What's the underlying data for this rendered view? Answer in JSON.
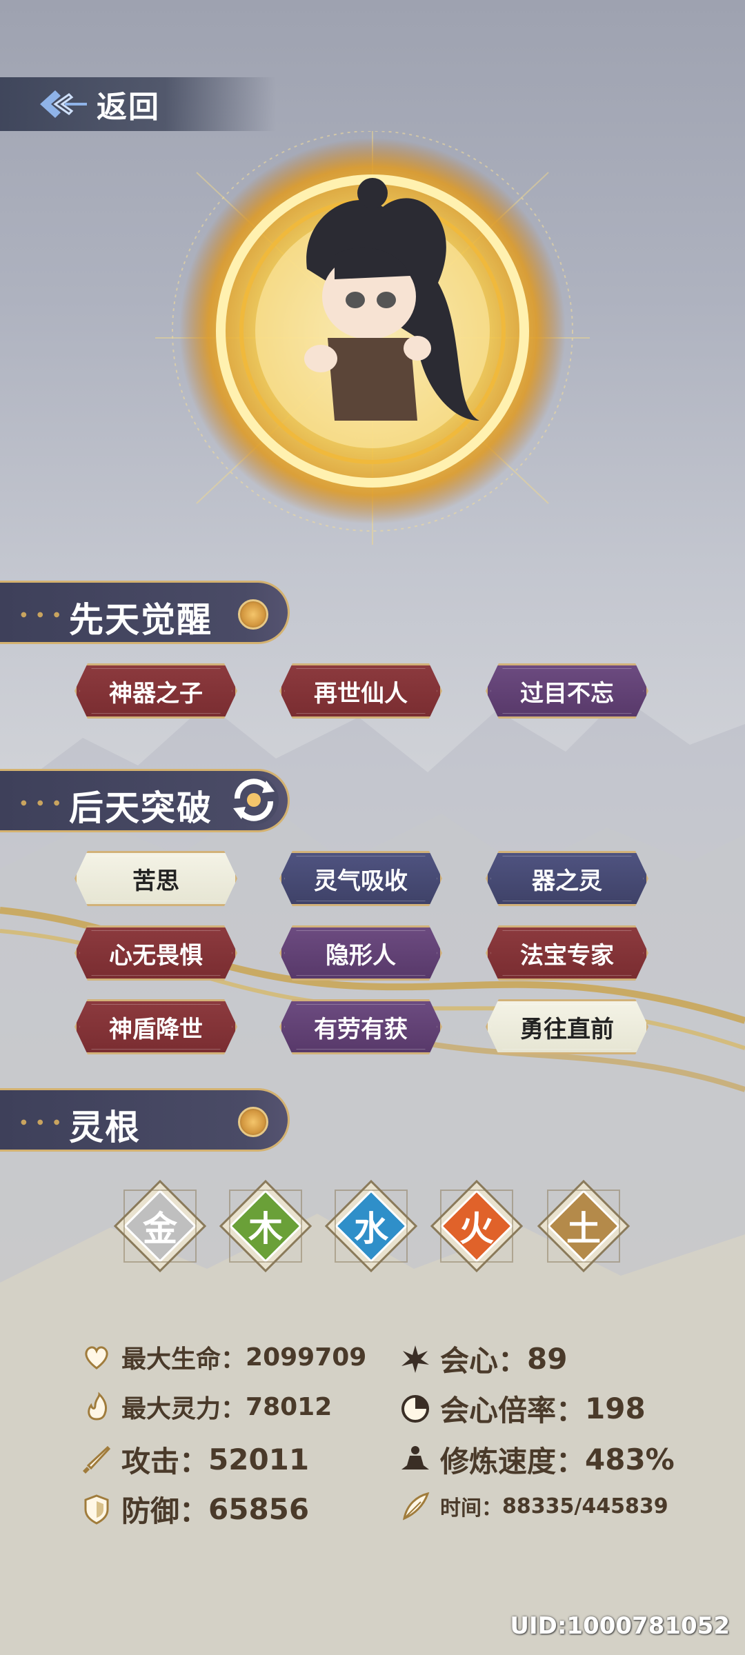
{
  "nav": {
    "back_label": "返回"
  },
  "sections": {
    "innate": {
      "title": "先天觉醒"
    },
    "acquired": {
      "title": "后天突破"
    },
    "root": {
      "title": "灵根"
    }
  },
  "innate_traits": [
    {
      "label": "神器之子",
      "color": "red"
    },
    {
      "label": "再世仙人",
      "color": "red"
    },
    {
      "label": "过目不忘",
      "color": "purple"
    }
  ],
  "acquired_traits": [
    {
      "label": "苦思",
      "color": "cream"
    },
    {
      "label": "灵气吸收",
      "color": "navy"
    },
    {
      "label": "器之灵",
      "color": "navy"
    },
    {
      "label": "心无畏惧",
      "color": "red"
    },
    {
      "label": "隐形人",
      "color": "purple"
    },
    {
      "label": "法宝专家",
      "color": "red"
    },
    {
      "label": "神盾降世",
      "color": "red"
    },
    {
      "label": "有劳有获",
      "color": "purple"
    },
    {
      "label": "勇往直前",
      "color": "cream"
    }
  ],
  "spirit_roots": [
    {
      "glyph": "金",
      "name": "metal",
      "color": "#bfbfbf"
    },
    {
      "glyph": "木",
      "name": "wood",
      "color": "#6aa038"
    },
    {
      "glyph": "水",
      "name": "water",
      "color": "#2f8fc9"
    },
    {
      "glyph": "火",
      "name": "fire",
      "color": "#e0622a"
    },
    {
      "glyph": "土",
      "name": "earth",
      "color": "#b48a4a"
    }
  ],
  "stats": {
    "max_hp": {
      "label": "最大生命：",
      "value": "2099709",
      "icon": "heart-icon"
    },
    "crit": {
      "label": "会心：",
      "value": "89",
      "icon": "burst-icon"
    },
    "max_spirit": {
      "label": "最大灵力：",
      "value": "78012",
      "icon": "flame-icon"
    },
    "crit_rate": {
      "label": "会心倍率：",
      "value": "198",
      "icon": "target-icon"
    },
    "attack": {
      "label": "攻击：",
      "value": "52011",
      "icon": "sword-icon"
    },
    "cultivation_speed": {
      "label": "修炼速度：",
      "value": "483%",
      "icon": "meditation-icon"
    },
    "defense": {
      "label": "防御：",
      "value": "65856",
      "icon": "shield-icon"
    },
    "time": {
      "label": "时间：",
      "value": "88335/445839",
      "icon": "feather-icon"
    }
  },
  "uid": "UID:1000781052",
  "colors": {
    "gold": "#d4b270",
    "header_bg": "#3e405a",
    "stat_text": "#4a3a2a"
  }
}
